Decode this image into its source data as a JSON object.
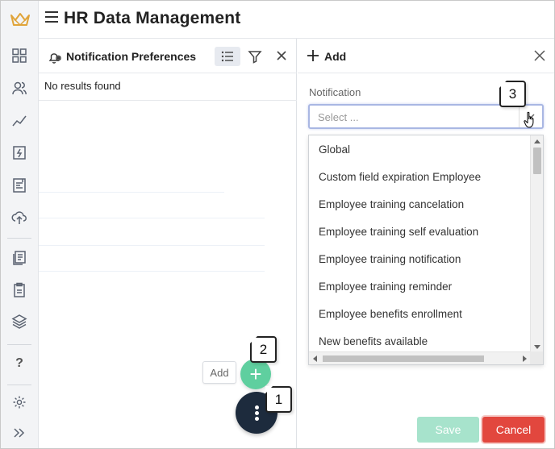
{
  "app": {
    "title": "HR Data Management"
  },
  "nav": {
    "items": [
      "grid-icon",
      "users-icon",
      "chart-icon",
      "flash-doc-icon",
      "report-icon",
      "cloud-upload-icon",
      "documents-icon",
      "clipboard-icon",
      "layers-icon"
    ],
    "help": "?",
    "settings": "gear-icon",
    "expand": "double-chevron-icon"
  },
  "left_panel": {
    "title": "Notification Preferences",
    "no_results": "No results found",
    "add_chip": "Add",
    "fab_add_symbol": "+"
  },
  "right_panel": {
    "title": "Add",
    "field_label": "Notification",
    "select_placeholder": "Select ...",
    "options": [
      "Global",
      "Custom field expiration Employee",
      "Employee training cancelation",
      "Employee training self evaluation",
      "Employee training notification",
      "Employee training reminder",
      "Employee benefits enrollment",
      "New benefits available"
    ],
    "save": "Save",
    "cancel": "Cancel"
  },
  "callouts": {
    "one": "1",
    "two": "2",
    "three": "3"
  },
  "colors": {
    "fab_add": "#5fcf9f",
    "fab_more": "#1d2b3d",
    "save_disabled": "#a7e3cc",
    "cancel": "#e2473e",
    "select_focus": "#a9b7e3"
  }
}
